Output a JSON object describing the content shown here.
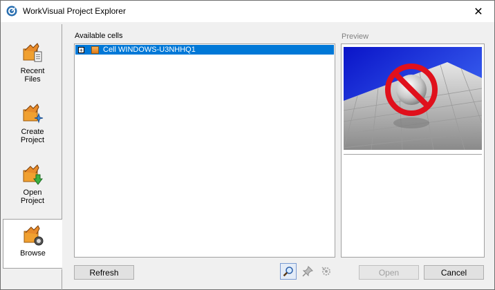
{
  "window": {
    "title": "WorkVisual Project Explorer",
    "close_glyph": "✕"
  },
  "sidebar": {
    "items": [
      {
        "label_line1": "Recent",
        "label_line2": "Files",
        "icon": "recent-files-icon"
      },
      {
        "label_line1": "Create",
        "label_line2": "Project",
        "icon": "create-project-icon"
      },
      {
        "label_line1": "Open",
        "label_line2": "Project",
        "icon": "open-project-icon"
      },
      {
        "label_line1": "Browse",
        "label_line2": "",
        "icon": "browse-icon",
        "active": true
      }
    ]
  },
  "cells": {
    "heading": "Available cells",
    "expander_glyph": "+",
    "items": [
      {
        "label": "Cell WINDOWS-U3NHHQ1",
        "selected": true
      }
    ]
  },
  "preview": {
    "heading": "Preview",
    "image_icon": "no-preview-prohibited-icon"
  },
  "toolbar": {
    "refresh_label": "Refresh",
    "open_label": "Open",
    "cancel_label": "Cancel",
    "tools": [
      "magnifier-icon",
      "pin-icon",
      "settings-icon"
    ]
  },
  "colors": {
    "selection": "#0078d7",
    "window_bg": "#f0f0f0",
    "preview_sky": "#1b2fd8",
    "prohibit_red": "#e0101c"
  }
}
